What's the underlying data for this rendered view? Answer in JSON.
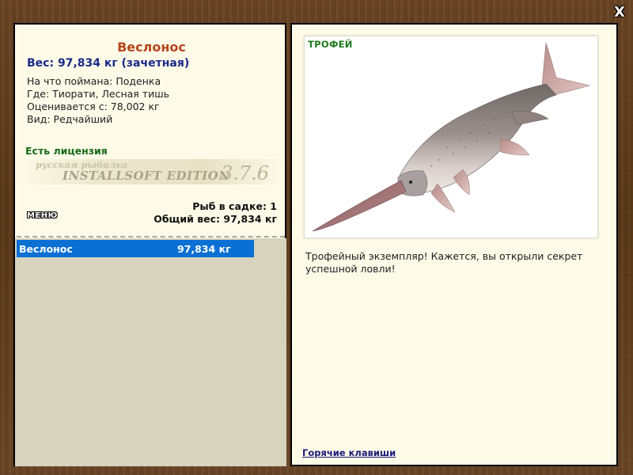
{
  "window": {
    "close_label": "X"
  },
  "fish": {
    "name": "Веслонос",
    "weight_line": "Вес: 97,834 кг (зачетная)",
    "info": [
      "На что поймана: Поденка",
      "Где: Тиорати, Лесная тишь",
      "Оценивается с: 78,002 кг",
      "Вид: Редчайший"
    ]
  },
  "license_text": "Есть лицензия",
  "watermark": {
    "top": "русская рыбалка",
    "main": "INSTALLSOFT EDITION",
    "version": "3.7.6"
  },
  "cage": {
    "count": "Рыб в садке: 1",
    "total": "Общий вес: 97,834 кг"
  },
  "menu_label": "МЕНЮ",
  "catch_list": [
    {
      "name": "Веслонос",
      "weight": "97,834 кг"
    }
  ],
  "trophy": {
    "label": "ТРОФЕЙ",
    "message": "Трофейный экземпляр! Кажется, вы открыли секрет успешной ловли!",
    "image": "paddlefish-image"
  },
  "hotkeys_label": "Горячие клавиши",
  "colors": {
    "wood": "#5f3d1f",
    "paper": "#fdfbe8",
    "title": "#b5461b",
    "weight": "#1a2a8a",
    "license": "#1a6b1a",
    "selection": "#0b70d4"
  }
}
